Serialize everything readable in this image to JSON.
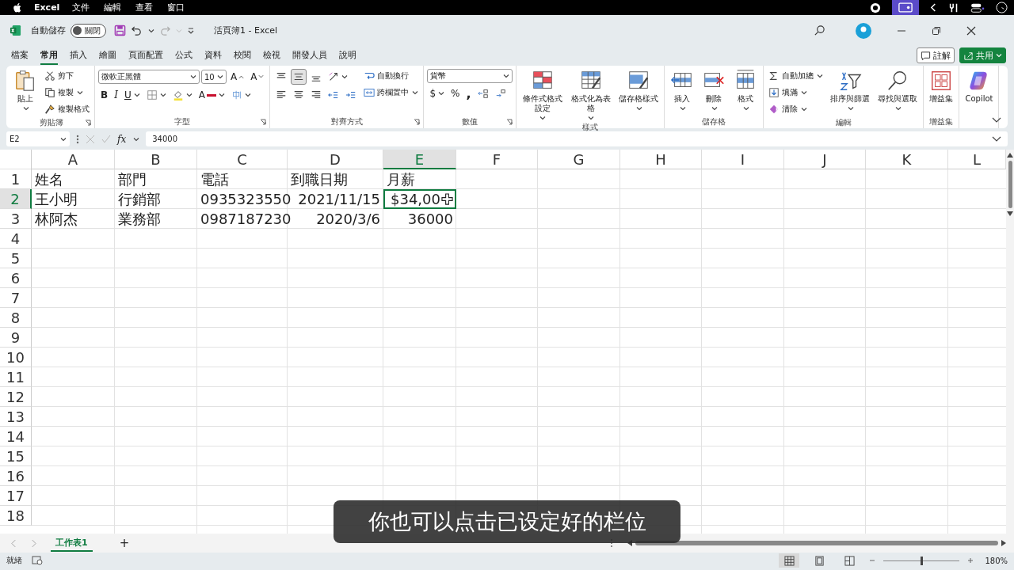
{
  "menubar": {
    "app": "Excel",
    "menus": [
      "文件",
      "編輯",
      "查看",
      "窗口"
    ]
  },
  "titlebar": {
    "autosave_label": "自動儲存",
    "autosave": {
      "on": false,
      "label": "關閉"
    },
    "title": "活頁簿1  -  Excel"
  },
  "ribbon_tabs": [
    {
      "label": "檔案",
      "selected": false
    },
    {
      "label": "常用",
      "selected": true
    },
    {
      "label": "插入",
      "selected": false
    },
    {
      "label": "繪圖",
      "selected": false
    },
    {
      "label": "頁面配置",
      "selected": false
    },
    {
      "label": "公式",
      "selected": false
    },
    {
      "label": "資料",
      "selected": false
    },
    {
      "label": "校閱",
      "selected": false
    },
    {
      "label": "檢視",
      "selected": false
    },
    {
      "label": "開發人員",
      "selected": false
    },
    {
      "label": "說明",
      "selected": false
    }
  ],
  "ribbon_actions": {
    "comment": "註解",
    "share": "共用"
  },
  "ribbon": {
    "groups": [
      {
        "label": "剪貼簿",
        "launcher": true,
        "items": [
          {
            "kind": "large",
            "label": "貼上",
            "caret": true
          },
          {
            "kind": "stack",
            "lines": [
              {
                "controls": [
                  {
                    "kind": "small",
                    "label": "剪下"
                  }
                ]
              },
              {
                "controls": [
                  {
                    "kind": "small",
                    "label": "複製",
                    "caret": true
                  }
                ]
              },
              {
                "controls": [
                  {
                    "kind": "small",
                    "label": "複製格式"
                  }
                ]
              }
            ]
          }
        ]
      },
      {
        "label": "字型",
        "launcher": true,
        "items": [
          {
            "kind": "stack",
            "lines": [
              {
                "controls": [
                  {
                    "kind": "combo",
                    "value": "微軟正黑體"
                  },
                  {
                    "kind": "combo",
                    "value": "10"
                  },
                  {
                    "kind": "tool",
                    "label": "A"
                  },
                  {
                    "kind": "tool",
                    "label": "A"
                  }
                ]
              },
              {
                "controls": [
                  {
                    "kind": "tool",
                    "label": "B"
                  },
                  {
                    "kind": "tool",
                    "label": "I"
                  },
                  {
                    "kind": "tool",
                    "label": "U",
                    "caret": true
                  },
                  {
                    "kind": "tool",
                    "caret": true
                  },
                  {
                    "kind": "tool",
                    "caret": true
                  },
                  {
                    "kind": "tool",
                    "label": "A",
                    "caret": true
                  },
                  {
                    "kind": "tool",
                    "caret": true
                  }
                ]
              }
            ]
          }
        ]
      },
      {
        "label": "對齊方式",
        "launcher": true,
        "items": [
          {
            "kind": "stack",
            "lines": [
              {
                "controls": [
                  {
                    "kind": "tool",
                    "selected": false
                  },
                  {
                    "kind": "tool",
                    "selected": true
                  },
                  {
                    "kind": "tool",
                    "selected": false
                  },
                  {
                    "kind": "tool",
                    "caret": true
                  }
                ]
              },
              {
                "controls": [
                  {
                    "kind": "tool",
                    "selected": false
                  },
                  {
                    "kind": "tool",
                    "selected": false
                  },
                  {
                    "kind": "tool",
                    "selected": false
                  },
                  {
                    "kind": "tool"
                  },
                  {
                    "kind": "tool"
                  }
                ]
              }
            ]
          },
          {
            "kind": "stack",
            "lines": [
              {
                "controls": [
                  {
                    "kind": "small",
                    "label": "自動換行"
                  }
                ]
              },
              {
                "controls": [
                  {
                    "kind": "small",
                    "label": "跨欄置中",
                    "caret": true
                  }
                ]
              }
            ]
          }
        ]
      },
      {
        "label": "數值",
        "launcher": true,
        "items": [
          {
            "kind": "stack",
            "lines": [
              {
                "controls": [
                  {
                    "kind": "combo",
                    "value": "貨幣"
                  }
                ]
              },
              {
                "controls": [
                  {
                    "kind": "tool",
                    "label": "$",
                    "caret": true
                  },
                  {
                    "kind": "tool",
                    "label": "%"
                  },
                  {
                    "kind": "tool",
                    "label": ","
                  },
                  {
                    "kind": "tool"
                  },
                  {
                    "kind": "tool"
                  }
                ]
              }
            ]
          }
        ]
      },
      {
        "label": "樣式",
        "items": [
          {
            "kind": "large",
            "label": "條件式格式設定",
            "caret": true
          },
          {
            "kind": "large",
            "label": "格式化為表格",
            "caret": true
          },
          {
            "kind": "large",
            "label": "儲存格樣式",
            "caret": true
          }
        ]
      },
      {
        "label": "儲存格",
        "items": [
          {
            "kind": "large",
            "label": "插入",
            "caret": true
          },
          {
            "kind": "large",
            "label": "刪除",
            "caret": true
          },
          {
            "kind": "large",
            "label": "格式",
            "caret": true
          }
        ]
      },
      {
        "label": "編輯",
        "items": [
          {
            "kind": "stack",
            "lines": [
              {
                "controls": [
                  {
                    "kind": "small",
                    "label": "自動加總",
                    "caret": true
                  }
                ]
              },
              {
                "controls": [
                  {
                    "kind": "small",
                    "label": "填滿",
                    "caret": true
                  }
                ]
              },
              {
                "controls": [
                  {
                    "kind": "small",
                    "label": "清除",
                    "caret": true
                  }
                ]
              }
            ]
          },
          {
            "kind": "large",
            "label": "排序與篩選",
            "caret": true
          },
          {
            "kind": "large",
            "label": "尋找與選取",
            "caret": true
          }
        ]
      },
      {
        "label": "增益集",
        "items": [
          {
            "kind": "large",
            "label": "增益集"
          }
        ]
      },
      {
        "items": [
          {
            "kind": "large",
            "label": "Copilot"
          }
        ]
      }
    ]
  },
  "formula_bar": {
    "name_box": "E2",
    "fx": "fx",
    "value": "34000"
  },
  "sheet": {
    "columns": [
      {
        "label": "A",
        "selected": false
      },
      {
        "label": "B",
        "selected": false
      },
      {
        "label": "C",
        "selected": false
      },
      {
        "label": "D",
        "selected": false
      },
      {
        "label": "E",
        "selected": true
      },
      {
        "label": "F",
        "selected": false
      },
      {
        "label": "G",
        "selected": false
      },
      {
        "label": "H",
        "selected": false
      },
      {
        "label": "I",
        "selected": false
      },
      {
        "label": "J",
        "selected": false
      },
      {
        "label": "K",
        "selected": false
      },
      {
        "label": "L",
        "selected": false
      }
    ],
    "rows": [
      {
        "header": "1",
        "selected": false,
        "cells": [
          {
            "text": "姓名",
            "right_aligned": false,
            "selected": false
          },
          {
            "text": "部門",
            "right_aligned": false,
            "selected": false
          },
          {
            "text": "電話",
            "right_aligned": false,
            "selected": false
          },
          {
            "text": "到職日期",
            "right_aligned": false,
            "selected": false
          },
          {
            "text": "月薪",
            "right_aligned": false,
            "selected": false
          }
        ]
      },
      {
        "header": "2",
        "selected": true,
        "cells": [
          {
            "text": "王小明",
            "right_aligned": false,
            "selected": false
          },
          {
            "text": "行銷部",
            "right_aligned": false,
            "selected": false
          },
          {
            "text": "0935323550",
            "right_aligned": false,
            "selected": false
          },
          {
            "text": "2021/11/15",
            "right_aligned": true,
            "selected": false
          },
          {
            "text": "$34,00",
            "right_aligned": true,
            "selected": true
          }
        ]
      },
      {
        "header": "3",
        "selected": false,
        "cells": [
          {
            "text": "林阿杰",
            "right_aligned": false,
            "selected": false
          },
          {
            "text": "業務部",
            "right_aligned": false,
            "selected": false
          },
          {
            "text": "0987187230",
            "right_aligned": false,
            "selected": false
          },
          {
            "text": "2020/3/6",
            "right_aligned": true,
            "selected": false
          },
          {
            "text": "36000",
            "right_aligned": true,
            "selected": false
          }
        ]
      },
      {
        "header": "4",
        "selected": false
      },
      {
        "header": "5",
        "selected": false
      },
      {
        "header": "6",
        "selected": false
      },
      {
        "header": "7",
        "selected": false
      },
      {
        "header": "8",
        "selected": false
      },
      {
        "header": "9",
        "selected": false
      },
      {
        "header": "10",
        "selected": false
      },
      {
        "header": "11",
        "selected": false
      },
      {
        "header": "12",
        "selected": false
      },
      {
        "header": "13",
        "selected": false
      },
      {
        "header": "14",
        "selected": false
      },
      {
        "header": "15",
        "selected": false
      },
      {
        "header": "16",
        "selected": false
      },
      {
        "header": "17",
        "selected": false
      },
      {
        "header": "18",
        "selected": false
      }
    ]
  },
  "sheet_tabs": [
    {
      "label": "工作表1",
      "selected": true
    }
  ],
  "add_sheet": "+",
  "status_bar": {
    "status": "就緒",
    "views": [
      {
        "selected": true
      },
      {
        "selected": false
      },
      {
        "selected": false
      }
    ],
    "zoom": {
      "level": 0.5,
      "reading": "180%"
    }
  },
  "caption": "你也可以点击已设定好的栏位"
}
